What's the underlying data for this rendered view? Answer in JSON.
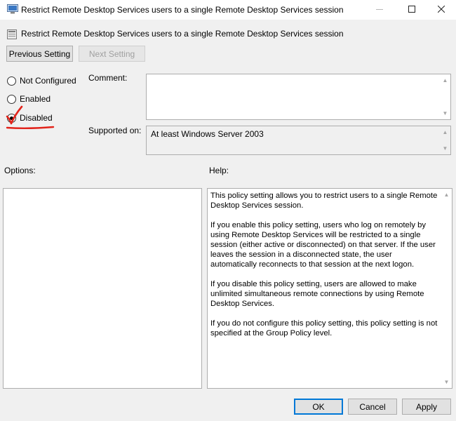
{
  "window": {
    "title": "Restrict Remote Desktop Services users to a single Remote Desktop Services session"
  },
  "dialog": {
    "heading": "Restrict Remote Desktop Services users to a single Remote Desktop Services session",
    "nav": {
      "previous_label": "Previous Setting",
      "next_label": "Next Setting",
      "next_enabled": false
    },
    "state_options": [
      {
        "label": "Not Configured",
        "selected": false
      },
      {
        "label": "Enabled",
        "selected": false
      },
      {
        "label": "Disabled",
        "selected": true
      }
    ],
    "comment_label": "Comment:",
    "comment_value": "",
    "supported_label": "Supported on:",
    "supported_value": "At least Windows Server 2003",
    "options_label": "Options:",
    "help_label": "Help:",
    "help_paragraphs": [
      "This policy setting allows you to restrict users to a single Remote Desktop Services session.",
      "If you enable this policy setting, users who log on remotely by using Remote Desktop Services will be restricted to a single session (either active or disconnected) on that server. If the user leaves the session in a disconnected state, the user automatically reconnects to that session at the next logon.",
      "If you disable this policy setting, users are allowed to make unlimited simultaneous remote connections by using Remote Desktop Services.",
      "If you do not configure this policy setting,  this policy setting is not specified at the Group Policy level."
    ],
    "buttons": {
      "ok_label": "OK",
      "cancel_label": "Cancel",
      "apply_label": "Apply"
    }
  },
  "icons": {
    "app": "policy-window-icon",
    "heading": "policy-setting-icon",
    "minimize": "minimize-icon",
    "maximize": "maximize-icon",
    "close": "close-icon"
  },
  "colors": {
    "dialog_bg": "#f0f0f0",
    "accent": "#0078d7",
    "annotation": "#e2231a"
  }
}
